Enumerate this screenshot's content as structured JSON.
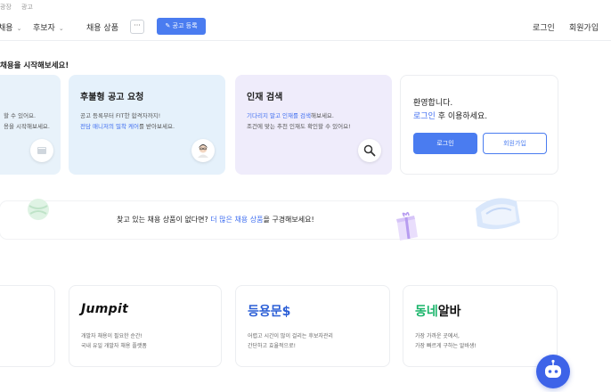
{
  "top_strip": {
    "left_text": "광장",
    "right_text": "광고"
  },
  "nav": {
    "items": [
      {
        "label": "채용"
      },
      {
        "label": "후보자"
      },
      {
        "label": "채용 상품"
      }
    ],
    "more_label": "···",
    "post_button_label": "공고 등록",
    "login_label": "로그인",
    "signup_label": "회원가입"
  },
  "headline": "채용을 시작해보세요!",
  "cards": [
    {
      "title": "",
      "desc_line1": "할 수 있어요.",
      "desc_line2": "용을 시작해보세요."
    },
    {
      "title": "후불형 공고 요청",
      "desc_line1": "공고 등록부터 FIT한 합격자까지!",
      "desc_line2_highlight": "전담 매니저의 밀착 케어",
      "desc_line2_rest": "를 받아보세요."
    },
    {
      "title": "인재 검색",
      "desc_line1_highlight": "기다리지 말고 인재를 검색",
      "desc_line1_rest": "해보세요.",
      "desc_line2": "조건에 맞는 추천 인재도 확인할 수 있어요!"
    }
  ],
  "login_panel": {
    "welcome": "환영합니다.",
    "welcome2_highlight": "로그인",
    "welcome2_rest": " 후 이용하세요.",
    "login_button": "로그인",
    "signup_button": "회원가입"
  },
  "banner": {
    "text_before": "찾고 있는 채용 상품이 없다면? ",
    "text_highlight": "더 많은 채용 상품",
    "text_after": "을 구경해보세요!"
  },
  "services": [
    {
      "logo": "",
      "desc_line1": "",
      "desc_line2": ""
    },
    {
      "logo": "Jumpit",
      "desc_line1": "개발자 채용이 필요한 순간!",
      "desc_line2": "국내 유일 개발자 채용 플랫폼"
    },
    {
      "logo": "등용문$",
      "desc_line1": "어렵고 시간이 많이 걸리는 후보자관리",
      "desc_line2": "간단하고 효율적으로!"
    },
    {
      "logo_part1": "동네",
      "logo_part2": "알바",
      "desc_line1": "가장 가까운 곳에서,",
      "desc_line2": "가장 빠르게 구하는 알바생!"
    }
  ],
  "colors": {
    "accent": "#4a7cf0",
    "highlight_text": "#3f6ef0",
    "card_blue": "#e5f1fb",
    "card_purple": "#efecfb",
    "dongne_green": "#19b46a"
  }
}
